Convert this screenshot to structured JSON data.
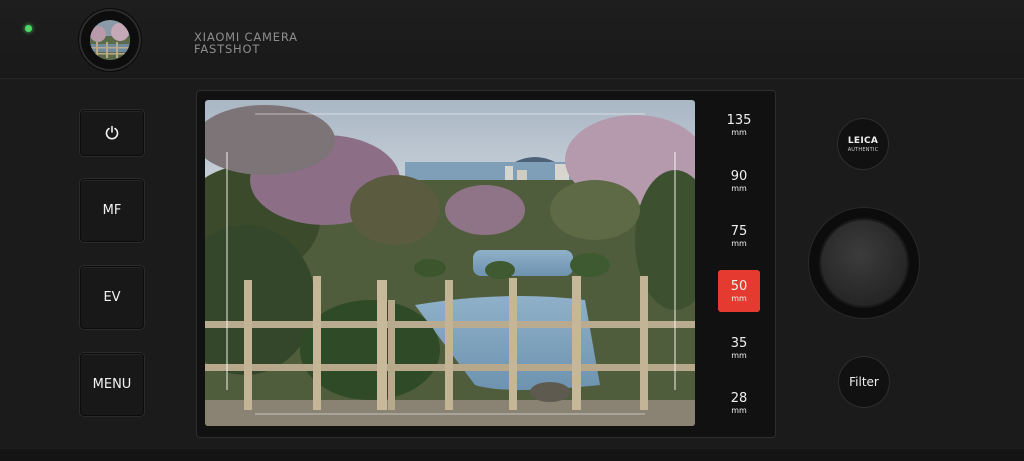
{
  "app": {
    "brand_line1": "XIAOMI CAMERA",
    "brand_line2": "FASTSHOT"
  },
  "status": {
    "indicator_color": "#4cd964"
  },
  "side_buttons": [
    {
      "label": "",
      "icon": "power-icon"
    },
    {
      "label": "MF"
    },
    {
      "label": "EV"
    },
    {
      "label": "MENU"
    }
  ],
  "focal_lengths": [
    {
      "value": "135",
      "unit": "mm",
      "active": false
    },
    {
      "value": "90",
      "unit": "mm",
      "active": false
    },
    {
      "value": "75",
      "unit": "mm",
      "active": false
    },
    {
      "value": "50",
      "unit": "mm",
      "active": true
    },
    {
      "value": "35",
      "unit": "mm",
      "active": false
    },
    {
      "value": "28",
      "unit": "mm",
      "active": false
    }
  ],
  "leica": {
    "line1": "LEICA",
    "line2": "AUTHENTIC"
  },
  "filter_label": "Filter",
  "colors": {
    "accent": "#e53a2f",
    "background": "#1b1b1b"
  }
}
